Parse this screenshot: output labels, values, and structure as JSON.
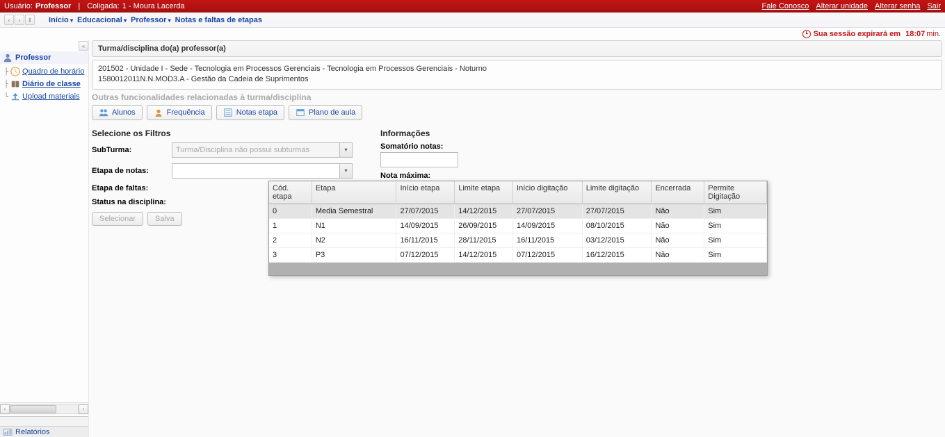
{
  "topbar": {
    "userLabel": "Usuário:",
    "userName": "Professor",
    "coligadaLabel": "Coligada:",
    "coligadaValue": "1 - Moura Lacerda",
    "links": {
      "contact": "Fale Conosco",
      "changeUnit": "Alterar unidade",
      "changePass": "Alterar senha",
      "logout": "Sair"
    }
  },
  "breadcrumb": {
    "items": [
      "Início",
      "Educacional",
      "Professor"
    ],
    "current": "Notas e faltas de etapas"
  },
  "session": {
    "text": "Sua sessão expirará em",
    "time": "18:07",
    "suffix": "min."
  },
  "sidebar": {
    "title": "Professor",
    "items": [
      {
        "label": "Quadro de horário",
        "icon": "clock"
      },
      {
        "label": "Diário de classe",
        "icon": "book",
        "current": true
      },
      {
        "label": "Upload materiais",
        "icon": "upload"
      }
    ],
    "reports": "Relatórios"
  },
  "panel": {
    "header": "Turma/disciplina do(a) professor(a)",
    "line1": "201502 - Unidade I - Sede - Tecnologia em Processos Gerenciais - Tecnologia em Processos Gerenciais - Noturno",
    "line2": "1580012011N.N.MOD3.A - Gestão da Cadeia de Suprimentos",
    "related": "Outras funcionalidades relacionadas à turma/disciplina"
  },
  "toolbar": {
    "alunos": "Alunos",
    "freq": "Frequência",
    "notas": "Notas etapa",
    "plano": "Plano de aula"
  },
  "filters": {
    "title": "Selecione os Filtros",
    "subturma": "SubTurma:",
    "subturmaValue": "Turma/Disciplina não possui subturmas",
    "etapaNotas": "Etapa de notas:",
    "etapaFaltas": "Etapa de faltas:",
    "status": "Status na disciplina:",
    "selecionar": "Selecionar",
    "salvar": "Salva"
  },
  "info": {
    "title": "Informações",
    "somatorio": "Somatório notas:",
    "notaMax": "Nota máxima:"
  },
  "table": {
    "headers": [
      "Cód. etapa",
      "Etapa",
      "Início etapa",
      "Limite etapa",
      "Início digitação",
      "Limite digitação",
      "Encerrada",
      "Permite Digitação"
    ],
    "rows": [
      {
        "cod": "0",
        "etapa": "Media Semestral",
        "inicio": "27/07/2015",
        "limite": "14/12/2015",
        "inicioDig": "27/07/2015",
        "limiteDig": "27/07/2015",
        "encerrada": "Não",
        "permite": "Sim",
        "sel": true
      },
      {
        "cod": "1",
        "etapa": "N1",
        "inicio": "14/09/2015",
        "limite": "26/09/2015",
        "inicioDig": "14/09/2015",
        "limiteDig": "08/10/2015",
        "encerrada": "Não",
        "permite": "Sim"
      },
      {
        "cod": "2",
        "etapa": "N2",
        "inicio": "16/11/2015",
        "limite": "28/11/2015",
        "inicioDig": "16/11/2015",
        "limiteDig": "03/12/2015",
        "encerrada": "Não",
        "permite": "Sim"
      },
      {
        "cod": "3",
        "etapa": "P3",
        "inicio": "07/12/2015",
        "limite": "14/12/2015",
        "inicioDig": "07/12/2015",
        "limiteDig": "16/12/2015",
        "encerrada": "Não",
        "permite": "Sim"
      }
    ]
  }
}
